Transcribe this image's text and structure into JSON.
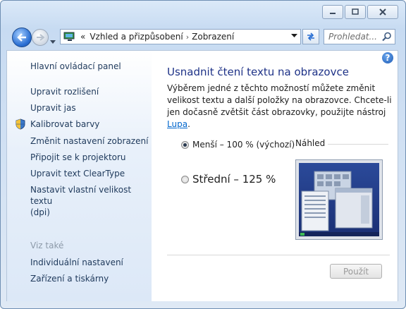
{
  "address": {
    "root_chevron": "«",
    "crumbs": [
      "Vzhled a přizpůsobení",
      "Zobrazení"
    ],
    "separator": "›"
  },
  "search": {
    "placeholder": "Prohledat..."
  },
  "sidebar": {
    "home": "Hlavní ovládací panel",
    "items": [
      "Upravit rozlišení",
      "Upravit jas",
      "Kalibrovat barvy",
      "Změnit nastavení zobrazení",
      "Připojit se k projektoru",
      "Upravit text ClearType",
      "Nastavit vlastní velikost textu",
      "(dpi)"
    ],
    "see_also_header": "Viz také",
    "see_also": [
      "Individuální nastavení",
      "Zařízení a tiskárny"
    ]
  },
  "main": {
    "title": "Usnadnit čtení textu na obrazovce",
    "desc_1": "Výběrem jedné z těchto možností můžete změnit velikost textu a další položky na obrazovce. Chcete-li jen dočasně zvětšit část obrazovky, použijte nástroj ",
    "desc_link": "Lupa",
    "desc_2": ".",
    "option_small": "Menší – 100 % (výchozí)",
    "option_medium": "Střední – 125 %",
    "selected": "option_small",
    "preview_label": "Náhled",
    "apply": "Použít"
  },
  "help": "?",
  "colors": {
    "title_blue": "#1e3287",
    "link_blue": "#0066cc",
    "sidebar_text": "#1e395b"
  }
}
